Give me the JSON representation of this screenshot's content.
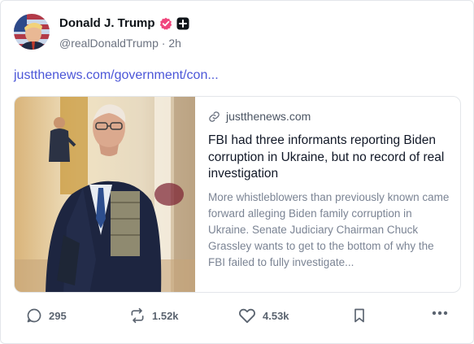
{
  "author": {
    "display_name": "Donald J. Trump",
    "handle": "@realDonaldTrump",
    "separator": "·",
    "time_ago": "2h",
    "verified_color": "#f0467d"
  },
  "post": {
    "link_text": "justthenews.com/government/con...",
    "link_color": "#4b56d8"
  },
  "card": {
    "domain": "justthenews.com",
    "title": "FBI had three informants reporting Biden corruption in Ukraine, but no record of real investigation",
    "description": "More whistleblowers than previously known came forward alleging Biden family corruption in Ukraine. Senate Judiciary Chairman Chuck Grassley wants to get to the bottom of why the FBI failed to fully investigate...",
    "image_icon": "photo-thumbnail"
  },
  "actions": {
    "replies": "295",
    "retruths": "1.52k",
    "likes": "4.53k",
    "reply_icon": "comment-icon",
    "retruth_icon": "repost-icon",
    "like_icon": "heart-icon",
    "bookmark_icon": "bookmark-icon",
    "more_icon": "more-icon"
  }
}
